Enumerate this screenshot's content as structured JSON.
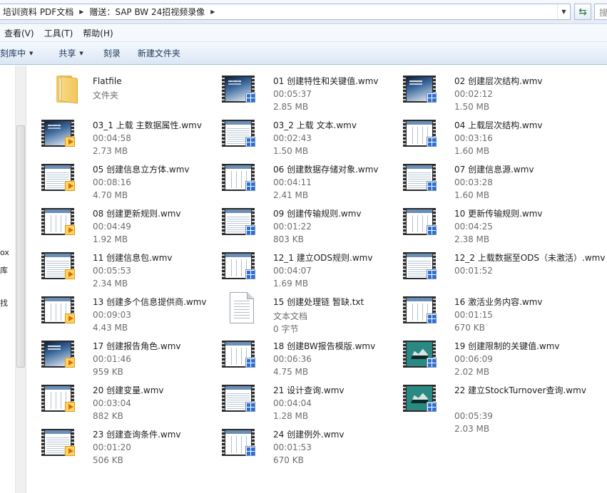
{
  "address_bar": {
    "crumbs": [
      "培训资料 PDF文档",
      "赠送：SAP BW 24招视频录像"
    ],
    "search_placeholder": "搜"
  },
  "menu": [
    "查看(V)",
    "工具(T)",
    "帮助(H)"
  ],
  "commands": {
    "include_library": "刻库中",
    "share": "共享",
    "burn": "刻录",
    "new_folder": "新建文件夹"
  },
  "nav_partial_labels": [
    "ox",
    "库",
    "找"
  ],
  "files": [
    {
      "name": "Flatfile",
      "line2": "文件夹",
      "line3": "",
      "icon": "folder-icon",
      "thumb": ""
    },
    {
      "name": "01 创建特性和关键值.wmv",
      "line2": "00:05:37",
      "line3": "2.85 MB",
      "icon": "video-icon",
      "thumb": "desk"
    },
    {
      "name": "02 创建层次结构.wmv",
      "line2": "00:02:12",
      "line3": "1.50 MB",
      "icon": "video-icon",
      "thumb": "desk"
    },
    {
      "name": "03_1 上载 主数据属性.wmv",
      "line2": "00:04:58",
      "line3": "2.73 MB",
      "icon": "video-icon",
      "thumb": "desk"
    },
    {
      "name": "03_2 上载 文本.wmv",
      "line2": "00:02:43",
      "line3": "1.50 MB",
      "icon": "video-icon",
      "thumb": "sap"
    },
    {
      "name": "04 上载层次结构.wmv",
      "line2": "00:03:16",
      "line3": "1.60 MB",
      "icon": "video-icon",
      "thumb": "sap"
    },
    {
      "name": "05 创建信息立方体.wmv",
      "line2": "00:08:16",
      "line3": "4.70 MB",
      "icon": "video-icon",
      "thumb": "sap"
    },
    {
      "name": "06 创建数据存储对象.wmv",
      "line2": "00:04:11",
      "line3": "2.41 MB",
      "icon": "video-icon",
      "thumb": "sap"
    },
    {
      "name": "07 创建信息源.wmv",
      "line2": "00:03:28",
      "line3": "1.60 MB",
      "icon": "video-icon",
      "thumb": "sap"
    },
    {
      "name": "08 创建更新规则.wmv",
      "line2": "00:04:49",
      "line3": "1.92 MB",
      "icon": "video-icon",
      "thumb": "sap"
    },
    {
      "name": "09 创建传输规则.wmv",
      "line2": "00:01:22",
      "line3": "803 KB",
      "icon": "video-icon",
      "thumb": "sap"
    },
    {
      "name": "10 更新传输规则.wmv",
      "line2": "00:04:25",
      "line3": "2.38 MB",
      "icon": "video-icon",
      "thumb": "sap"
    },
    {
      "name": "11 创建信息包.wmv",
      "line2": "00:05:53",
      "line3": "2.34 MB",
      "icon": "video-icon",
      "thumb": "sap"
    },
    {
      "name": "12_1 建立ODS规则.wmv",
      "line2": "00:04:07",
      "line3": "1.69 MB",
      "icon": "video-icon",
      "thumb": "sap"
    },
    {
      "name": "12_2 上载数据至ODS（未激活）.wmv",
      "line2": "00:01:52",
      "line3": "",
      "icon": "video-icon",
      "thumb": "sap"
    },
    {
      "name": "13 创建多个信息提供商.wmv",
      "line2": "00:09:03",
      "line3": "4.43 MB",
      "icon": "video-icon",
      "thumb": "sap"
    },
    {
      "name": "15 创建处理链 暂缺.txt",
      "line2": "文本文档",
      "line3": "0 字节",
      "icon": "text-document-icon",
      "thumb": ""
    },
    {
      "name": "16 激活业务内容.wmv",
      "line2": "00:01:15",
      "line3": "670 KB",
      "icon": "video-icon",
      "thumb": "sap"
    },
    {
      "name": "17 创建报告角色.wmv",
      "line2": "00:01:46",
      "line3": "959 KB",
      "icon": "video-icon",
      "thumb": "desk"
    },
    {
      "name": "18 创建BW报告模版.wmv",
      "line2": "00:06:36",
      "line3": "4.75 MB",
      "icon": "video-icon",
      "thumb": "sap"
    },
    {
      "name": "19 创建限制的关键值.wmv",
      "line2": "00:06:09",
      "line3": "2.02 MB",
      "icon": "video-icon",
      "thumb": "teal"
    },
    {
      "name": "20 创建变量.wmv",
      "line2": "00:03:04",
      "line3": "882 KB",
      "icon": "video-icon",
      "thumb": "sap"
    },
    {
      "name": "21 设计查询.wmv",
      "line2": "00:04:04",
      "line3": "1.28 MB",
      "icon": "video-icon",
      "thumb": "sap"
    },
    {
      "name": "22 建立StockTurnover查询.wmv",
      "line2": "00:05:39",
      "line3": "2.03 MB",
      "icon": "video-icon",
      "thumb": "teal"
    },
    {
      "name": "23 创建查询条件.wmv",
      "line2": "00:01:20",
      "line3": "506 KB",
      "icon": "video-icon",
      "thumb": "sap"
    },
    {
      "name": "24 创建例外.wmv",
      "line2": "00:01:53",
      "line3": "670 KB",
      "icon": "video-icon",
      "thumb": "sap"
    }
  ]
}
